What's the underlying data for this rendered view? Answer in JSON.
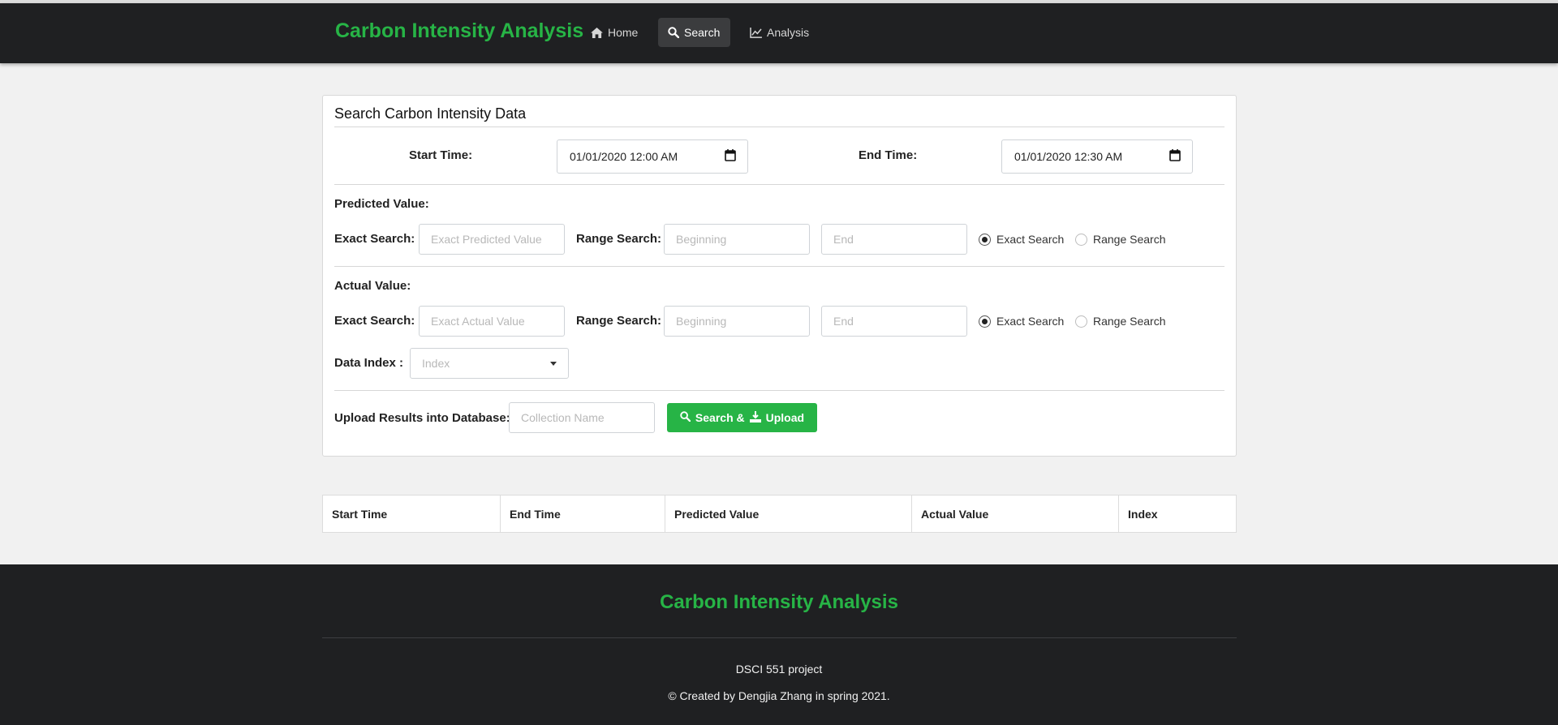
{
  "nav": {
    "brand": "Carbon Intensity Analysis",
    "items": [
      {
        "label": "Home",
        "icon": "home-icon"
      },
      {
        "label": "Search",
        "icon": "search-icon",
        "active": true
      },
      {
        "label": "Analysis",
        "icon": "line-chart-icon"
      }
    ]
  },
  "form": {
    "title": "Search Carbon Intensity Data",
    "start_time_label": "Start Time:",
    "start_time_value": "01/01/2020 12:00 AM",
    "end_time_label": "End Time:",
    "end_time_value": "01/01/2020 12:30 AM",
    "predicted": {
      "heading": "Predicted Value:",
      "exact_label": "Exact Search:",
      "exact_placeholder": "Exact Predicted Value",
      "range_label": "Range Search:",
      "range_begin_placeholder": "Beginning",
      "range_end_placeholder": "End",
      "radio_exact": "Exact Search",
      "radio_range": "Range Search",
      "selected": "exact"
    },
    "actual": {
      "heading": "Actual Value:",
      "exact_label": "Exact Search:",
      "exact_placeholder": "Exact Actual Value",
      "range_label": "Range Search:",
      "range_begin_placeholder": "Beginning",
      "range_end_placeholder": "End",
      "radio_exact": "Exact Search",
      "radio_range": "Range Search",
      "selected": "exact"
    },
    "data_index_label": "Data Index :",
    "data_index_placeholder": "Index",
    "upload_label": "Upload Results into Database:",
    "collection_placeholder": "Collection Name",
    "button_search_text": "Search &",
    "button_upload_text": "Upload"
  },
  "table": {
    "columns": [
      "Start Time",
      "End Time",
      "Predicted Value",
      "Actual Value",
      "Index"
    ]
  },
  "footer": {
    "brand": "Carbon Intensity Analysis",
    "project": "DSCI 551 project",
    "credit": "© Created by Dengjia Zhang in spring 2021."
  },
  "colors": {
    "accent": "#27b446",
    "navbar": "#1f2022"
  }
}
